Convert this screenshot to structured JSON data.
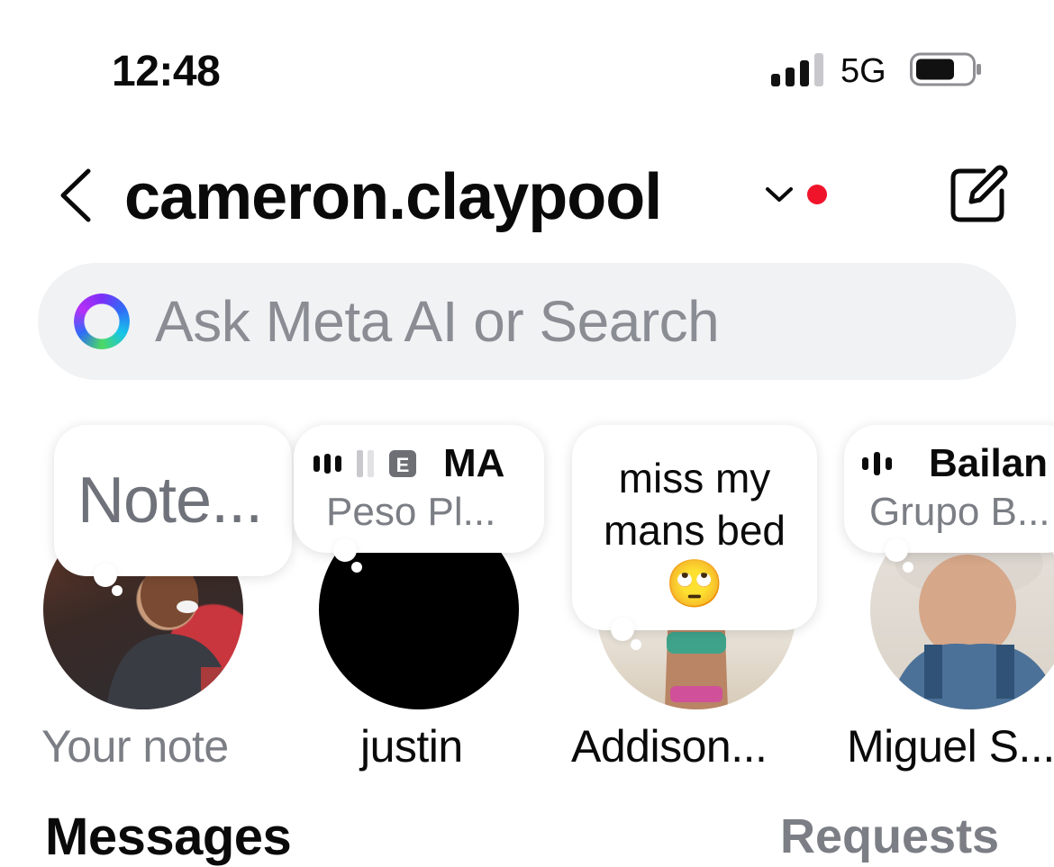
{
  "status_bar": {
    "time": "12:48",
    "network": "5G"
  },
  "header": {
    "username": "cameron.claypool"
  },
  "search": {
    "placeholder": "Ask Meta AI or Search"
  },
  "notes": [
    {
      "note_text": "Note...",
      "name": "Your note"
    },
    {
      "song_title": "MA",
      "artist": "Peso Pl...",
      "name": "justin"
    },
    {
      "note_text": "miss my mans bed",
      "emoji": "🙄",
      "name": "Addison..."
    },
    {
      "song_title": "Bailan",
      "artist": "Grupo B...",
      "name": "Miguel S..."
    }
  ],
  "sections": {
    "messages": "Messages",
    "requests": "Requests"
  },
  "colors": {
    "unread_dot": "#f0142b",
    "muted_text": "#7b7e84",
    "search_bg": "#f1f2f4"
  }
}
